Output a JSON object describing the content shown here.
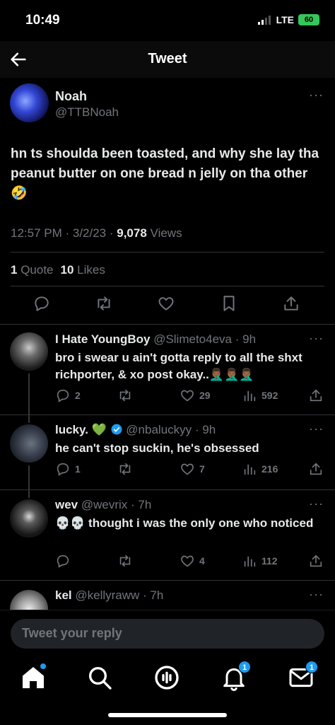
{
  "status_bar": {
    "time": "10:49",
    "network": "LTE",
    "battery": "60"
  },
  "header": {
    "title": "Tweet"
  },
  "main_tweet": {
    "name": "Noah",
    "handle": "@TTBNoah",
    "text": "hn ts shoulda been toasted, and why she lay tha peanut butter on one bread n jelly on tha other 🤣",
    "time": "12:57 PM",
    "date": "3/2/23",
    "views_count": "9,078",
    "views_label": "Views",
    "quotes_count": "1",
    "quotes_label": "Quote",
    "likes_count": "10",
    "likes_label": "Likes"
  },
  "replies": [
    {
      "name": "I Hate YoungBoy",
      "handle": "@Slimeto4eva",
      "age": "9h",
      "text": "bro i swear u ain't gotta reply to all the shxt richporter, & xo post okay..🤦🏾‍♂️🤦🏾‍♂️🤦🏾‍♂️",
      "replies": "2",
      "retweets": "",
      "likes": "29",
      "views": "592"
    },
    {
      "name": "lucky. 💚",
      "handle": "@nbaluckyy",
      "age": "9h",
      "verified": true,
      "text": "he can't stop suckin, he's obsessed",
      "replies": "1",
      "retweets": "",
      "likes": "7",
      "views": "216"
    },
    {
      "name": "wev",
      "handle": "@wevrix",
      "age": "7h",
      "text": "💀💀 thought i was the only one who noticed",
      "replies": "",
      "retweets": "",
      "likes": "4",
      "views": "112"
    },
    {
      "name": "kel",
      "handle": "@kellyraww",
      "age": "7h",
      "text": ""
    }
  ],
  "reply_box": {
    "placeholder": "Tweet your reply"
  },
  "bottom_nav": {
    "notifications_badge": "1",
    "messages_badge": "1"
  },
  "colors": {
    "accent": "#1d9bf0",
    "verified": "#1d9bf0",
    "battery": "#34c759"
  }
}
